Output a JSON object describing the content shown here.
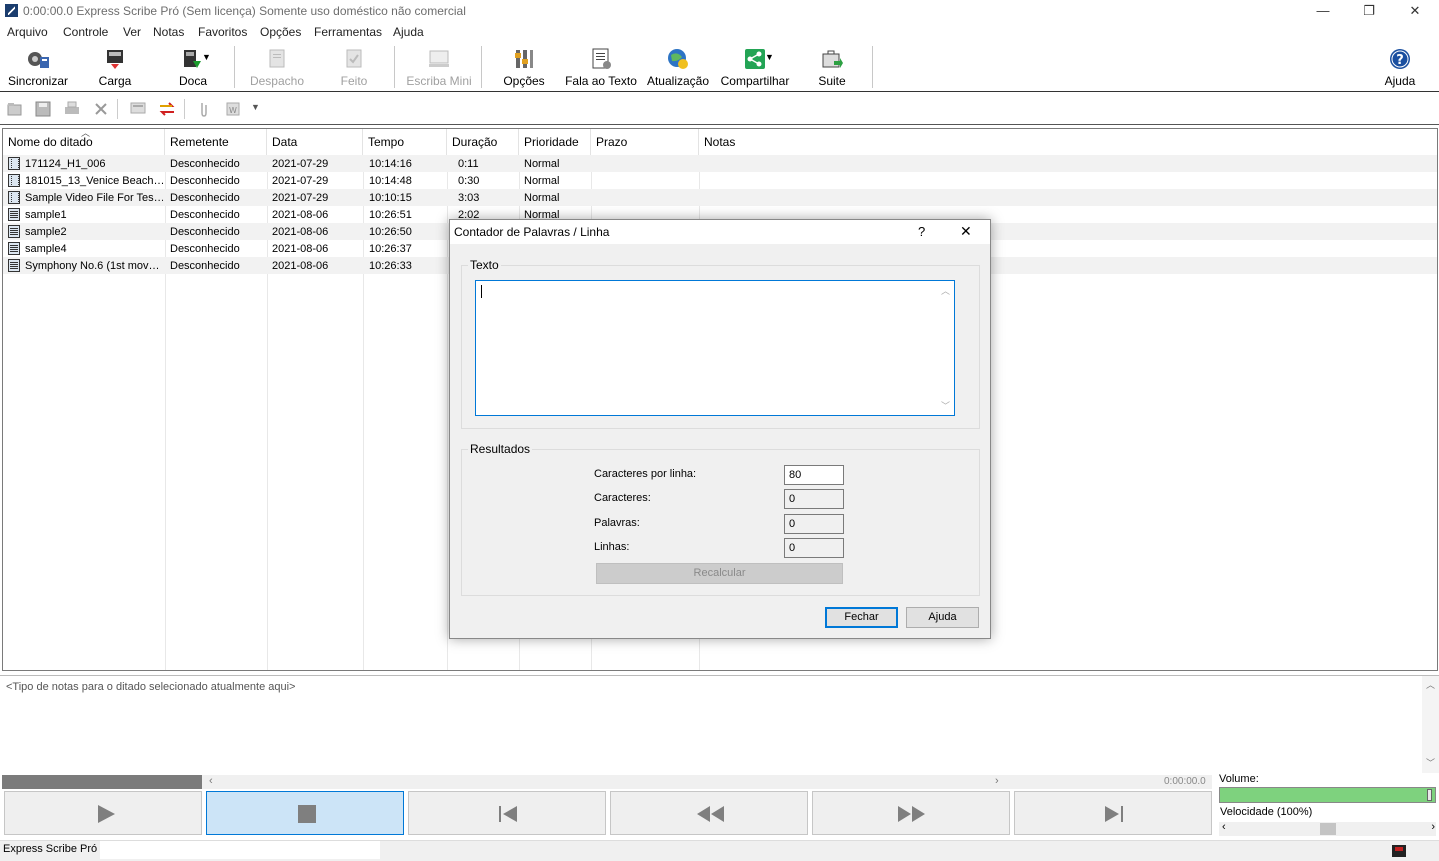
{
  "window": {
    "title": "0:00:00.0 Express Scribe Pró (Sem licença) Somente uso doméstico não comercial",
    "minimize_glyph": "—",
    "restore_glyph": "❐",
    "close_glyph": "✕"
  },
  "menu": [
    "Arquivo",
    "Controle",
    "Ver",
    "Notas",
    "Favoritos",
    "Opções",
    "Ferramentas",
    "Ajuda"
  ],
  "toolbar": {
    "items": [
      {
        "label": "Sincronizar",
        "icon": "sync-icon",
        "enabled": true
      },
      {
        "label": "Carga",
        "icon": "load-icon",
        "enabled": true
      },
      {
        "label": "Doca",
        "icon": "dock-icon",
        "enabled": true
      },
      {
        "label": "Despacho",
        "icon": "dispatch-icon",
        "enabled": false
      },
      {
        "label": "Feito",
        "icon": "done-icon",
        "enabled": false
      },
      {
        "label": "Escriba Mini",
        "icon": "mini-icon",
        "enabled": false
      },
      {
        "label": "Opções",
        "icon": "options-icon",
        "enabled": true
      },
      {
        "label": "Fala ao Texto",
        "icon": "speech-to-text-icon",
        "enabled": true
      },
      {
        "label": "Atualização",
        "icon": "update-icon",
        "enabled": true
      },
      {
        "label": "Compartilhar",
        "icon": "share-icon",
        "enabled": true
      },
      {
        "label": "Suite",
        "icon": "suite-icon",
        "enabled": true
      }
    ],
    "help_label": "Ajuda"
  },
  "list": {
    "columns": [
      "Nome do ditado",
      "Remetente",
      "Data",
      "Tempo",
      "Duração",
      "Prioridade",
      "Prazo",
      "Notas"
    ],
    "rows": [
      {
        "type": "film",
        "name": "171124_H1_006",
        "sender": "Desconhecido",
        "date": "2021-07-29",
        "time": "10:14:16",
        "duration": "0:11",
        "priority": "Normal"
      },
      {
        "type": "film",
        "name": "181015_13_Venice Beach…",
        "sender": "Desconhecido",
        "date": "2021-07-29",
        "time": "10:14:48",
        "duration": "0:30",
        "priority": "Normal"
      },
      {
        "type": "film",
        "name": "Sample Video File For Tes…",
        "sender": "Desconhecido",
        "date": "2021-07-29",
        "time": "10:10:15",
        "duration": "3:03",
        "priority": "Normal"
      },
      {
        "type": "audio",
        "name": "sample1",
        "sender": "Desconhecido",
        "date": "2021-08-06",
        "time": "10:26:51",
        "duration": "2:02",
        "priority": "Normal"
      },
      {
        "type": "audio",
        "name": "sample2",
        "sender": "Desconhecido",
        "date": "2021-08-06",
        "time": "10:26:50",
        "duration": "",
        "priority": ""
      },
      {
        "type": "audio",
        "name": "sample4",
        "sender": "Desconhecido",
        "date": "2021-08-06",
        "time": "10:26:37",
        "duration": "",
        "priority": ""
      },
      {
        "type": "audio",
        "name": "Symphony No.6 (1st mov…",
        "sender": "Desconhecido",
        "date": "2021-08-06",
        "time": "10:26:33",
        "duration": "",
        "priority": ""
      }
    ]
  },
  "notes": {
    "placeholder": "<Tipo de notas para o ditado selecionado atualmente aqui>"
  },
  "playback": {
    "time": "0:00:00.0"
  },
  "right_panel": {
    "volume_label": "Volume:",
    "speed_label": "Velocidade (100%)",
    "volume_level": 1.0,
    "speed_level": 0.5
  },
  "status": {
    "text": "Express Scribe Pró"
  },
  "dialog": {
    "title": "Contador de Palavras / Linha",
    "help_glyph": "?",
    "close_glyph": "✕",
    "text_group": "Texto",
    "results_group": "Resultados",
    "fields": {
      "chars_per_line_label": "Caracteres por linha:",
      "chars_per_line": "80",
      "chars_label": "Caracteres:",
      "chars": "0",
      "words_label": "Palavras:",
      "words": "0",
      "lines_label": "Linhas:",
      "lines": "0"
    },
    "recalc": "Recalcular",
    "close_button": "Fechar",
    "help_button": "Ajuda"
  },
  "colors": {
    "accent": "#0078d7",
    "volume_fill": "#7ed27e",
    "active_button": "#cce4f7"
  }
}
